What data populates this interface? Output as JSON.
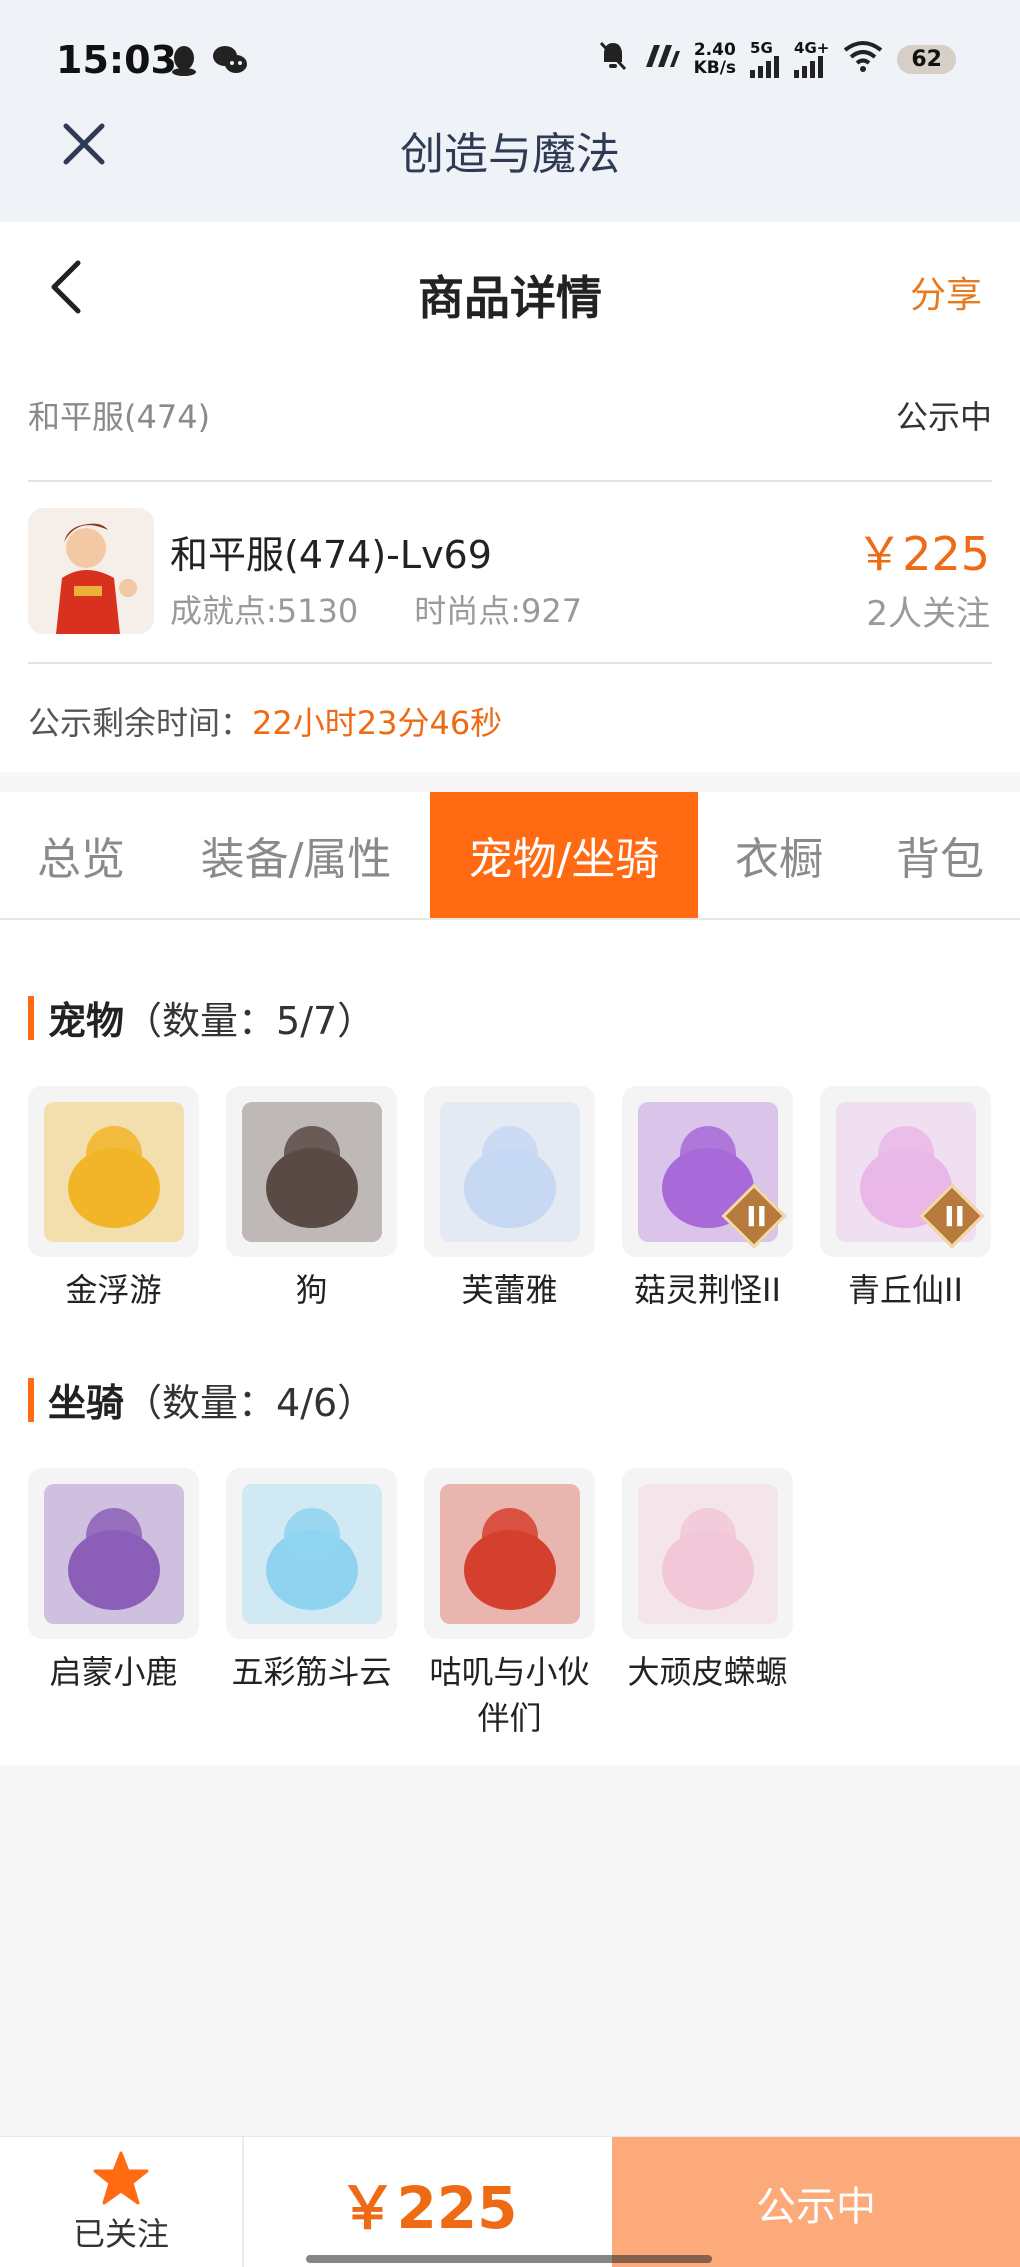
{
  "status_bar": {
    "time": "15:03",
    "speed_value": "2.40",
    "speed_unit": "KB/s",
    "net1": "5G",
    "net2": "4G+",
    "battery": "62",
    "icons": [
      "qq-icon",
      "wechat-icon",
      "mute-icon",
      "nfc-icon",
      "signal-icon",
      "signal-icon",
      "wifi-icon",
      "battery-icon"
    ]
  },
  "app": {
    "title": "创造与魔法",
    "close_icon": "close-icon"
  },
  "header": {
    "title": "商品详情",
    "share_label": "分享",
    "back_icon": "chevron-left-icon"
  },
  "listing": {
    "server": "和平服(474)",
    "status": "公示中",
    "character_name": "和平服(474)-Lv69",
    "achievement": "成就点:5130",
    "fashion": "时尚点:927",
    "price": "￥225",
    "watchers": "2人关注",
    "remain_label": "公示剩余时间：",
    "remain_value": "22小时23分46秒"
  },
  "tabs": [
    {
      "label": "总览",
      "active": false
    },
    {
      "label": "装备/属性",
      "active": false
    },
    {
      "label": "宠物/坐骑",
      "active": true
    },
    {
      "label": "衣橱",
      "active": false
    },
    {
      "label": "背包",
      "active": false
    }
  ],
  "pets": {
    "title": "宠物",
    "count": "（数量：5/7）",
    "items": [
      {
        "name": "金浮游",
        "color": "#f2b52a",
        "badge": ""
      },
      {
        "name": "狗",
        "color": "#5a4a45",
        "badge": ""
      },
      {
        "name": "芙蕾雅",
        "color": "#c7d8f3",
        "badge": ""
      },
      {
        "name": "菇灵荆怪II",
        "color": "#a86ad8",
        "badge": "II"
      },
      {
        "name": "青丘仙II",
        "color": "#e9b8e8",
        "badge": "II"
      }
    ]
  },
  "mounts": {
    "title": "坐骑",
    "count": "（数量：4/6）",
    "items": [
      {
        "name": "启蒙小鹿",
        "color": "#8b5fb8",
        "badge": ""
      },
      {
        "name": "五彩筋斗云",
        "color": "#8fd3f0",
        "badge": ""
      },
      {
        "name": "咕叽与小伙伴们",
        "color": "#d5402e",
        "badge": ""
      },
      {
        "name": "大顽皮蝾螈",
        "color": "#f2c8d8",
        "badge": ""
      }
    ]
  },
  "bottom_bar": {
    "follow_label": "已关注",
    "follow_icon": "star-icon",
    "price": "￥225",
    "status": "公示中",
    "accent": "#ff6a12"
  }
}
